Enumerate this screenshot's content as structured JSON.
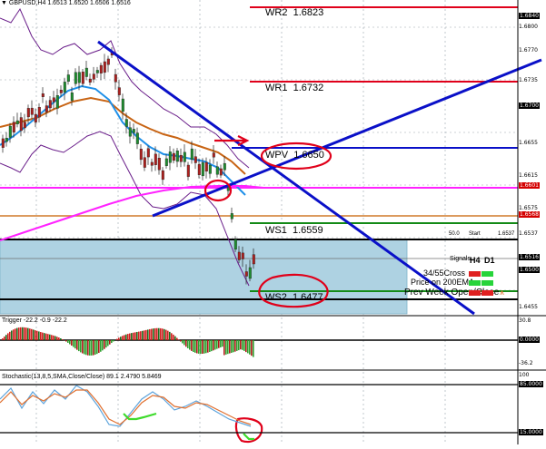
{
  "header": {
    "dropdown_icon": "triangle-down-icon",
    "symbol": "GBPUSD,H4",
    "ohlc": "1.6513 1.6520 1.6506 1.6516"
  },
  "pivots": {
    "wr2": {
      "label": "WR2",
      "value": "1.6823"
    },
    "wr1": {
      "label": "WR1",
      "value": "1.6732"
    },
    "wpv": {
      "label": "WPV",
      "value": "1.6650"
    },
    "ws1": {
      "label": "WS1",
      "value": "1.6559"
    },
    "ws2": {
      "label": "WS2",
      "value": "1.6477"
    }
  },
  "price_axis": [
    "1.6840",
    "1.6800",
    "1.6770",
    "1.6735",
    "1.6700",
    "1.6655",
    "1.6615",
    "1.6601",
    "1.6575",
    "1.6568",
    "1.6537",
    "1.6516",
    "1.6500",
    "1.6455"
  ],
  "signals": {
    "small_50": "50.0",
    "small_start": "Start",
    "small_value": "1.6537",
    "title": "Signals",
    "col_h4": "H4",
    "col_d1": "D1",
    "row1": "34/55Cross",
    "row2": "Price on 200EMA",
    "row3": "Prev Week Open/Close"
  },
  "trigger": {
    "label": "Trigger -22.2 -0.9 -22.2",
    "axis": [
      "30.8",
      "0.0000",
      "-36.2"
    ]
  },
  "stochastic": {
    "label": "Stochastic(13,8,5,SMA,Close/Close) 89.1 2.4790 5.8469",
    "axis": [
      "100",
      "85.0000",
      "15.0000"
    ]
  },
  "colors": {
    "background": "#ffffff",
    "blue_line": "#0a10c8",
    "pivot_red": "#e0001a",
    "green_line": "#138a16",
    "magenta_ema": "#ff22ff",
    "brown_ema": "#c86414",
    "teal_ema": "#1e8fe8",
    "bollinger": "#6a1e8a",
    "candle_green": "#1f8f2f",
    "candle_red": "#b0201e",
    "zone_fill": "#aed2e2",
    "stoch_orange": "#e07030",
    "stoch_blue": "#5ea4dc"
  }
}
